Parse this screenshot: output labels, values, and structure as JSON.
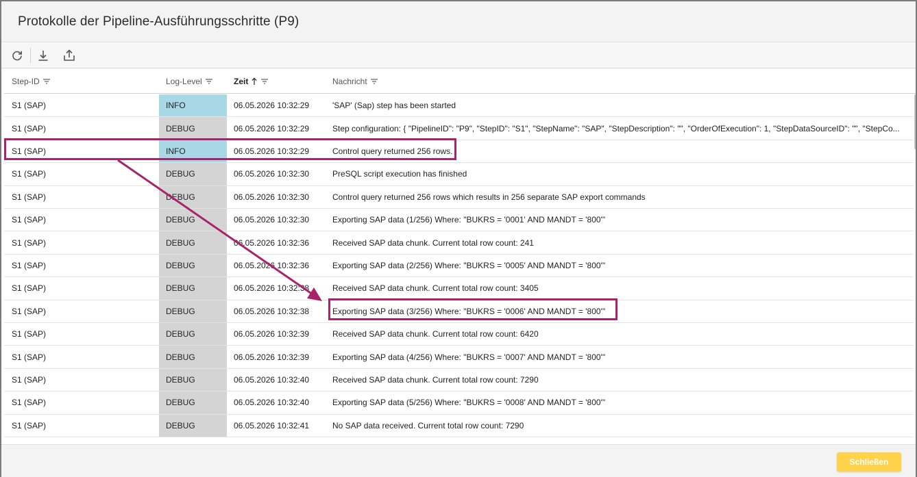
{
  "dialog": {
    "title": "Protokolle der Pipeline-Ausführungsschritte (P9)",
    "close_label": "Schließen"
  },
  "toolbar": {
    "icons": [
      "refresh-icon",
      "download-icon",
      "export-icon"
    ]
  },
  "columns": {
    "step_id": "Step-ID",
    "log_level": "Log-Level",
    "time": "Zeit",
    "message": "Nachricht",
    "sorted_column": "time",
    "sort_direction": "ascending"
  },
  "rows": [
    {
      "step": "S1 (SAP)",
      "level": "INFO",
      "time": "06.05.2026 10:32:29",
      "message": "'SAP' (Sap) step has been started"
    },
    {
      "step": "S1 (SAP)",
      "level": "DEBUG",
      "time": "06.05.2026 10:32:29",
      "message": "Step configuration: { \"PipelineID\": \"P9\", \"StepID\": \"S1\", \"StepName\": \"SAP\", \"StepDescription\": \"\", \"OrderOfExecution\": 1, \"StepDataSourceID\": \"\", \"StepCo..."
    },
    {
      "step": "S1 (SAP)",
      "level": "INFO",
      "time": "06.05.2026 10:32:29",
      "message": "Control query returned 256 rows."
    },
    {
      "step": "S1 (SAP)",
      "level": "DEBUG",
      "time": "06.05.2026 10:32:30",
      "message": "PreSQL script execution has finished"
    },
    {
      "step": "S1 (SAP)",
      "level": "DEBUG",
      "time": "06.05.2026 10:32:30",
      "message": "Control query returned 256 rows which results in 256 separate SAP export commands"
    },
    {
      "step": "S1 (SAP)",
      "level": "DEBUG",
      "time": "06.05.2026 10:32:30",
      "message": "Exporting SAP data (1/256) Where: \"BUKRS = '0001' AND MANDT = '800'\""
    },
    {
      "step": "S1 (SAP)",
      "level": "DEBUG",
      "time": "06.05.2026 10:32:36",
      "message": "Received SAP data chunk. Current total row count: 241"
    },
    {
      "step": "S1 (SAP)",
      "level": "DEBUG",
      "time": "06.05.2026 10:32:36",
      "message": "Exporting SAP data (2/256) Where: \"BUKRS = '0005' AND MANDT = '800'\""
    },
    {
      "step": "S1 (SAP)",
      "level": "DEBUG",
      "time": "06.05.2026 10:32:38",
      "message": "Received SAP data chunk. Current total row count: 3405"
    },
    {
      "step": "S1 (SAP)",
      "level": "DEBUG",
      "time": "06.05.2026 10:32:38",
      "message": "Exporting SAP data (3/256) Where: \"BUKRS = '0006' AND MANDT = '800'\""
    },
    {
      "step": "S1 (SAP)",
      "level": "DEBUG",
      "time": "06.05.2026 10:32:39",
      "message": "Received SAP data chunk. Current total row count: 6420"
    },
    {
      "step": "S1 (SAP)",
      "level": "DEBUG",
      "time": "06.05.2026 10:32:39",
      "message": "Exporting SAP data (4/256) Where: \"BUKRS = '0007' AND MANDT = '800'\""
    },
    {
      "step": "S1 (SAP)",
      "level": "DEBUG",
      "time": "06.05.2026 10:32:40",
      "message": "Received SAP data chunk. Current total row count: 7290"
    },
    {
      "step": "S1 (SAP)",
      "level": "DEBUG",
      "time": "06.05.2026 10:32:40",
      "message": "Exporting SAP data (5/256) Where: \"BUKRS = '0008' AND MANDT = '800'\""
    },
    {
      "step": "S1 (SAP)",
      "level": "DEBUG",
      "time": "06.05.2026 10:32:41",
      "message": "No SAP data received. Current total row count: 7290"
    }
  ],
  "colors": {
    "info_level": "#a8d8e6",
    "debug_level": "#d4d4d4",
    "highlight": "#a8246a",
    "close_button": "#ffd24a"
  },
  "annotations": {
    "highlighted_row": 2,
    "highlighted_message_row": 9
  }
}
